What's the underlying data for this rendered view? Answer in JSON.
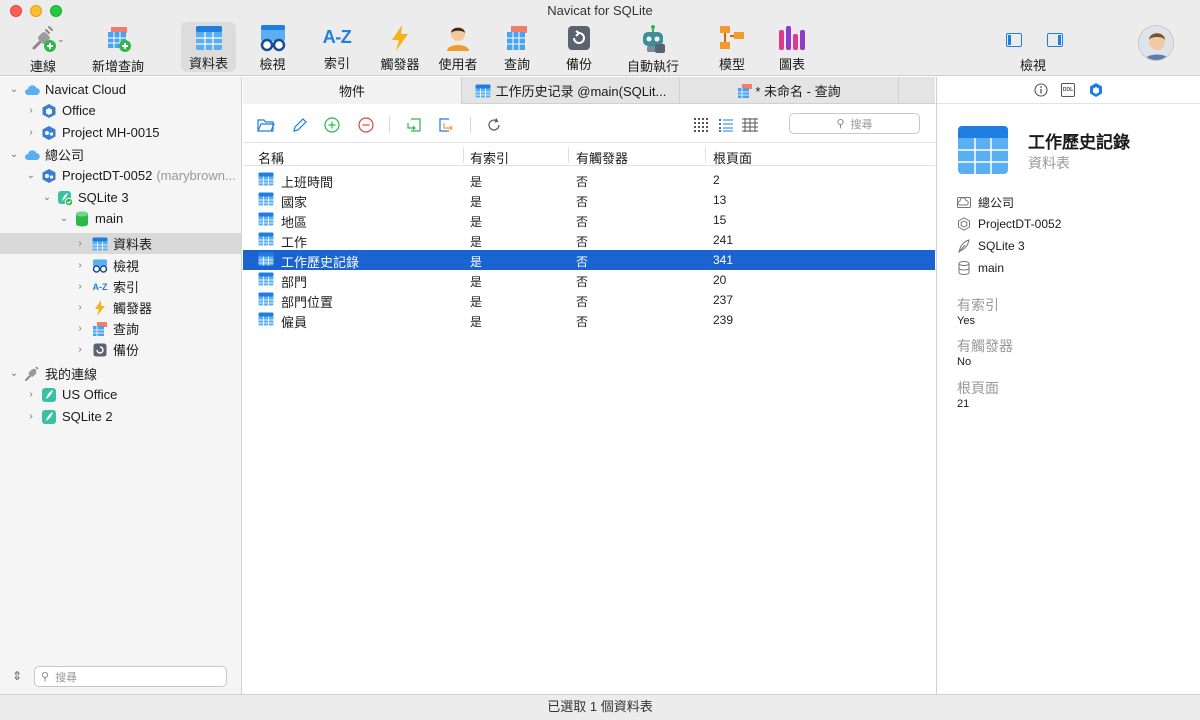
{
  "window": {
    "title": "Navicat for SQLite"
  },
  "toolbar": {
    "connect": "連線",
    "new_query": "新增查詢",
    "tables": "資料表",
    "views": "檢視",
    "indexes": "索引",
    "triggers": "觸發器",
    "users": "使用者",
    "queries": "查詢",
    "backup": "備份",
    "automation": "自動執行",
    "model": "模型",
    "charts": "圖表",
    "view_toggle": "檢視",
    "indexes_icon_text": "A-Z"
  },
  "sidebar": {
    "items": [
      {
        "label": "Navicat Cloud"
      },
      {
        "label": "Office"
      },
      {
        "label": "Project MH-0015"
      },
      {
        "label": "總公司"
      },
      {
        "label": "ProjectDT-0052",
        "suffix": "(marybrown..."
      },
      {
        "label": "SQLite 3"
      },
      {
        "label": "main"
      },
      {
        "label": "資料表"
      },
      {
        "label": "檢視"
      },
      {
        "label": "索引"
      },
      {
        "label": "觸發器"
      },
      {
        "label": "查詢"
      },
      {
        "label": "備份"
      },
      {
        "label": "我的連線"
      },
      {
        "label": "US Office"
      },
      {
        "label": "SQLite 2"
      }
    ],
    "search_placeholder": "搜尋",
    "index_icon_text": "A-Z"
  },
  "tabs": [
    {
      "label": "物件"
    },
    {
      "label": "工作历史记录 @main(SQLit..."
    },
    {
      "label": "* 未命名 - 查詢"
    }
  ],
  "objects": {
    "search_placeholder": "搜尋",
    "columns": [
      "名稱",
      "有索引",
      "有觸發器",
      "根頁面"
    ],
    "rows": [
      {
        "name": "上班時間",
        "has_index": "是",
        "has_trigger": "否",
        "root_page": "2"
      },
      {
        "name": "國家",
        "has_index": "是",
        "has_trigger": "否",
        "root_page": "13"
      },
      {
        "name": "地區",
        "has_index": "是",
        "has_trigger": "否",
        "root_page": "15"
      },
      {
        "name": "工作",
        "has_index": "是",
        "has_trigger": "否",
        "root_page": "241"
      },
      {
        "name": "工作歷史記錄",
        "has_index": "是",
        "has_trigger": "否",
        "root_page": "341"
      },
      {
        "name": "部門",
        "has_index": "是",
        "has_trigger": "否",
        "root_page": "20"
      },
      {
        "name": "部門位置",
        "has_index": "是",
        "has_trigger": "否",
        "root_page": "237"
      },
      {
        "name": "僱員",
        "has_index": "是",
        "has_trigger": "否",
        "root_page": "239"
      }
    ],
    "selected_row": 4
  },
  "detail": {
    "title": "工作歷史記錄",
    "subtitle": "資料表",
    "ddl_tab": "DDL",
    "location": [
      "總公司",
      "ProjectDT-0052",
      "SQLite 3",
      "main"
    ],
    "props": [
      {
        "key": "有索引",
        "value": "Yes"
      },
      {
        "key": "有觸發器",
        "value": "No"
      },
      {
        "key": "根頁面",
        "value": "21"
      }
    ]
  },
  "status": {
    "text": "已選取 1 個資料表"
  },
  "colors": {
    "selection": "#1b63d1",
    "accent_blue": "#1f7fe0",
    "green": "#2fb84a",
    "red": "#e0443e"
  }
}
